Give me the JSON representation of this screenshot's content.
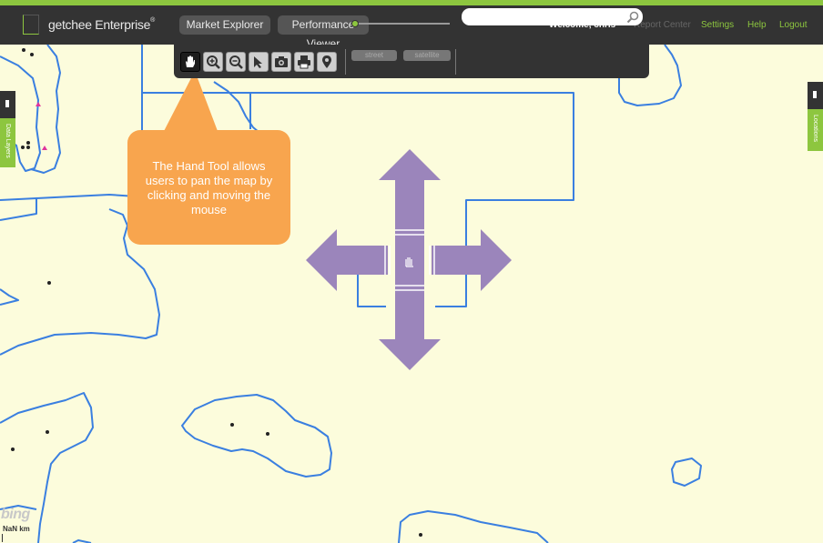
{
  "app": {
    "name": "getchee Enterprise",
    "trademark": "®"
  },
  "nav": {
    "market_explorer": "Market Explorer",
    "performance_viewer": "Performance Viewer"
  },
  "header": {
    "welcome": "Welcome, chris",
    "report_center": "Report Center",
    "settings": "Settings",
    "help": "Help",
    "logout": "Logout"
  },
  "toolbar": {
    "tools": [
      "hand-icon",
      "zoom-in-icon",
      "zoom-out-icon",
      "select-arrow-icon",
      "camera-icon",
      "print-icon",
      "map-pin-icon"
    ],
    "active_tool": "hand-icon",
    "street_label": "street",
    "satellite_label": "satellite",
    "search_value": "",
    "search_placeholder": ""
  },
  "side_tabs": {
    "left_label": "Data Layers",
    "right_label": "Locations"
  },
  "callout": {
    "text": "The Hand Tool allows users to pan the map by clicking and moving the mouse"
  },
  "map": {
    "attribution": "bing",
    "scale_text": "NaN km"
  },
  "colors": {
    "accent": "#8dc63f",
    "header_bg": "#333333",
    "map_bg": "#fcfcdc",
    "boundary": "#3a7fe0",
    "callout": "#f8a54e",
    "pan_arrows": "#9b85bb"
  }
}
